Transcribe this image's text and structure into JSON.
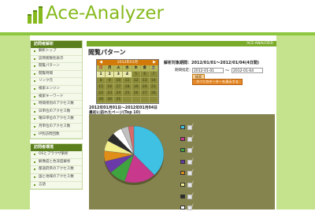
{
  "app": {
    "name": "Ace-Analyzer"
  },
  "breadcrumb": "ACE-ANALYZER",
  "page_title": "閲覧パターン",
  "menu": {
    "sections": [
      {
        "title": "訪問者解析",
        "items": [
          "解析トップ",
          "訪問者数別表示",
          "閲覧パターン",
          "閲覧時間",
          "リンク元",
          "検索エンジン",
          "検索キーワード",
          "時間帯別のアクセス数",
          "日単位のアクセス数",
          "曜日単位のアクセス数",
          "月単位のアクセス数",
          "IP別訪問回数"
        ]
      },
      {
        "title": "訪問者環境",
        "items": [
          "OSとブラウザ解析",
          "解像度と色深度解析",
          "都道府県のアクセス数",
          "国と地域のアクセス数",
          "言語"
        ]
      }
    ]
  },
  "calendar": {
    "title": "2012年01月",
    "weekdays": [
      "日",
      "月",
      "火",
      "水",
      "木",
      "金",
      "土"
    ],
    "weeks": [
      [
        "1",
        "2",
        "3",
        "4",
        "5",
        "6",
        "7"
      ],
      [
        "8",
        "9",
        "10",
        "11",
        "12",
        "13",
        "14"
      ],
      [
        "15",
        "16",
        "17",
        "18",
        "19",
        "20",
        "21"
      ],
      [
        "22",
        "23",
        "24",
        "25",
        "26",
        "27",
        "28"
      ],
      [
        "29",
        "30",
        "31",
        "",
        "",
        "",
        ""
      ]
    ],
    "selected": [
      "1",
      "2",
      "3",
      "4"
    ]
  },
  "range": {
    "label": "解析対象期間：2012/01/01〜2012/01/04(4日間)",
    "field_label": "期間指定：",
    "from": "2012-01-01",
    "to": "2012-01-04",
    "tilde": "〜",
    "search_button": "検索",
    "all_button": "すべてのデーターを表示する"
  },
  "chart_header": {
    "date": "2012年01月01日〜2012年01月04日",
    "title": "最初に訪れたページ(Top 10)"
  },
  "chart_data": {
    "type": "pie",
    "title": "",
    "slices": [
      {
        "value": 38,
        "color": "#3ec1e3"
      },
      {
        "value": 17,
        "color": "#c8388c"
      },
      {
        "value": 9,
        "color": "#3fa33f"
      },
      {
        "value": 7,
        "color": "#6a3aa8"
      },
      {
        "value": 6,
        "color": "#e08e1a"
      },
      {
        "value": 6,
        "color": "#f3ef8c"
      },
      {
        "value": 5,
        "color": "#2b2b2b"
      },
      {
        "value": 5,
        "color": "#ffffff"
      },
      {
        "value": 4,
        "color": "#c0c0c0"
      },
      {
        "value": 3,
        "color": "#d86a6a"
      }
    ],
    "legend_labels": [
      "/",
      "/",
      "/",
      "/",
      "/",
      "/",
      "/",
      "/",
      "/",
      "/"
    ]
  },
  "colors": {
    "accent_green": "#8dc63f",
    "bg_green": "#c5e38c",
    "menu_head": "#5c7f1d",
    "chart_bg": "#86844e"
  }
}
